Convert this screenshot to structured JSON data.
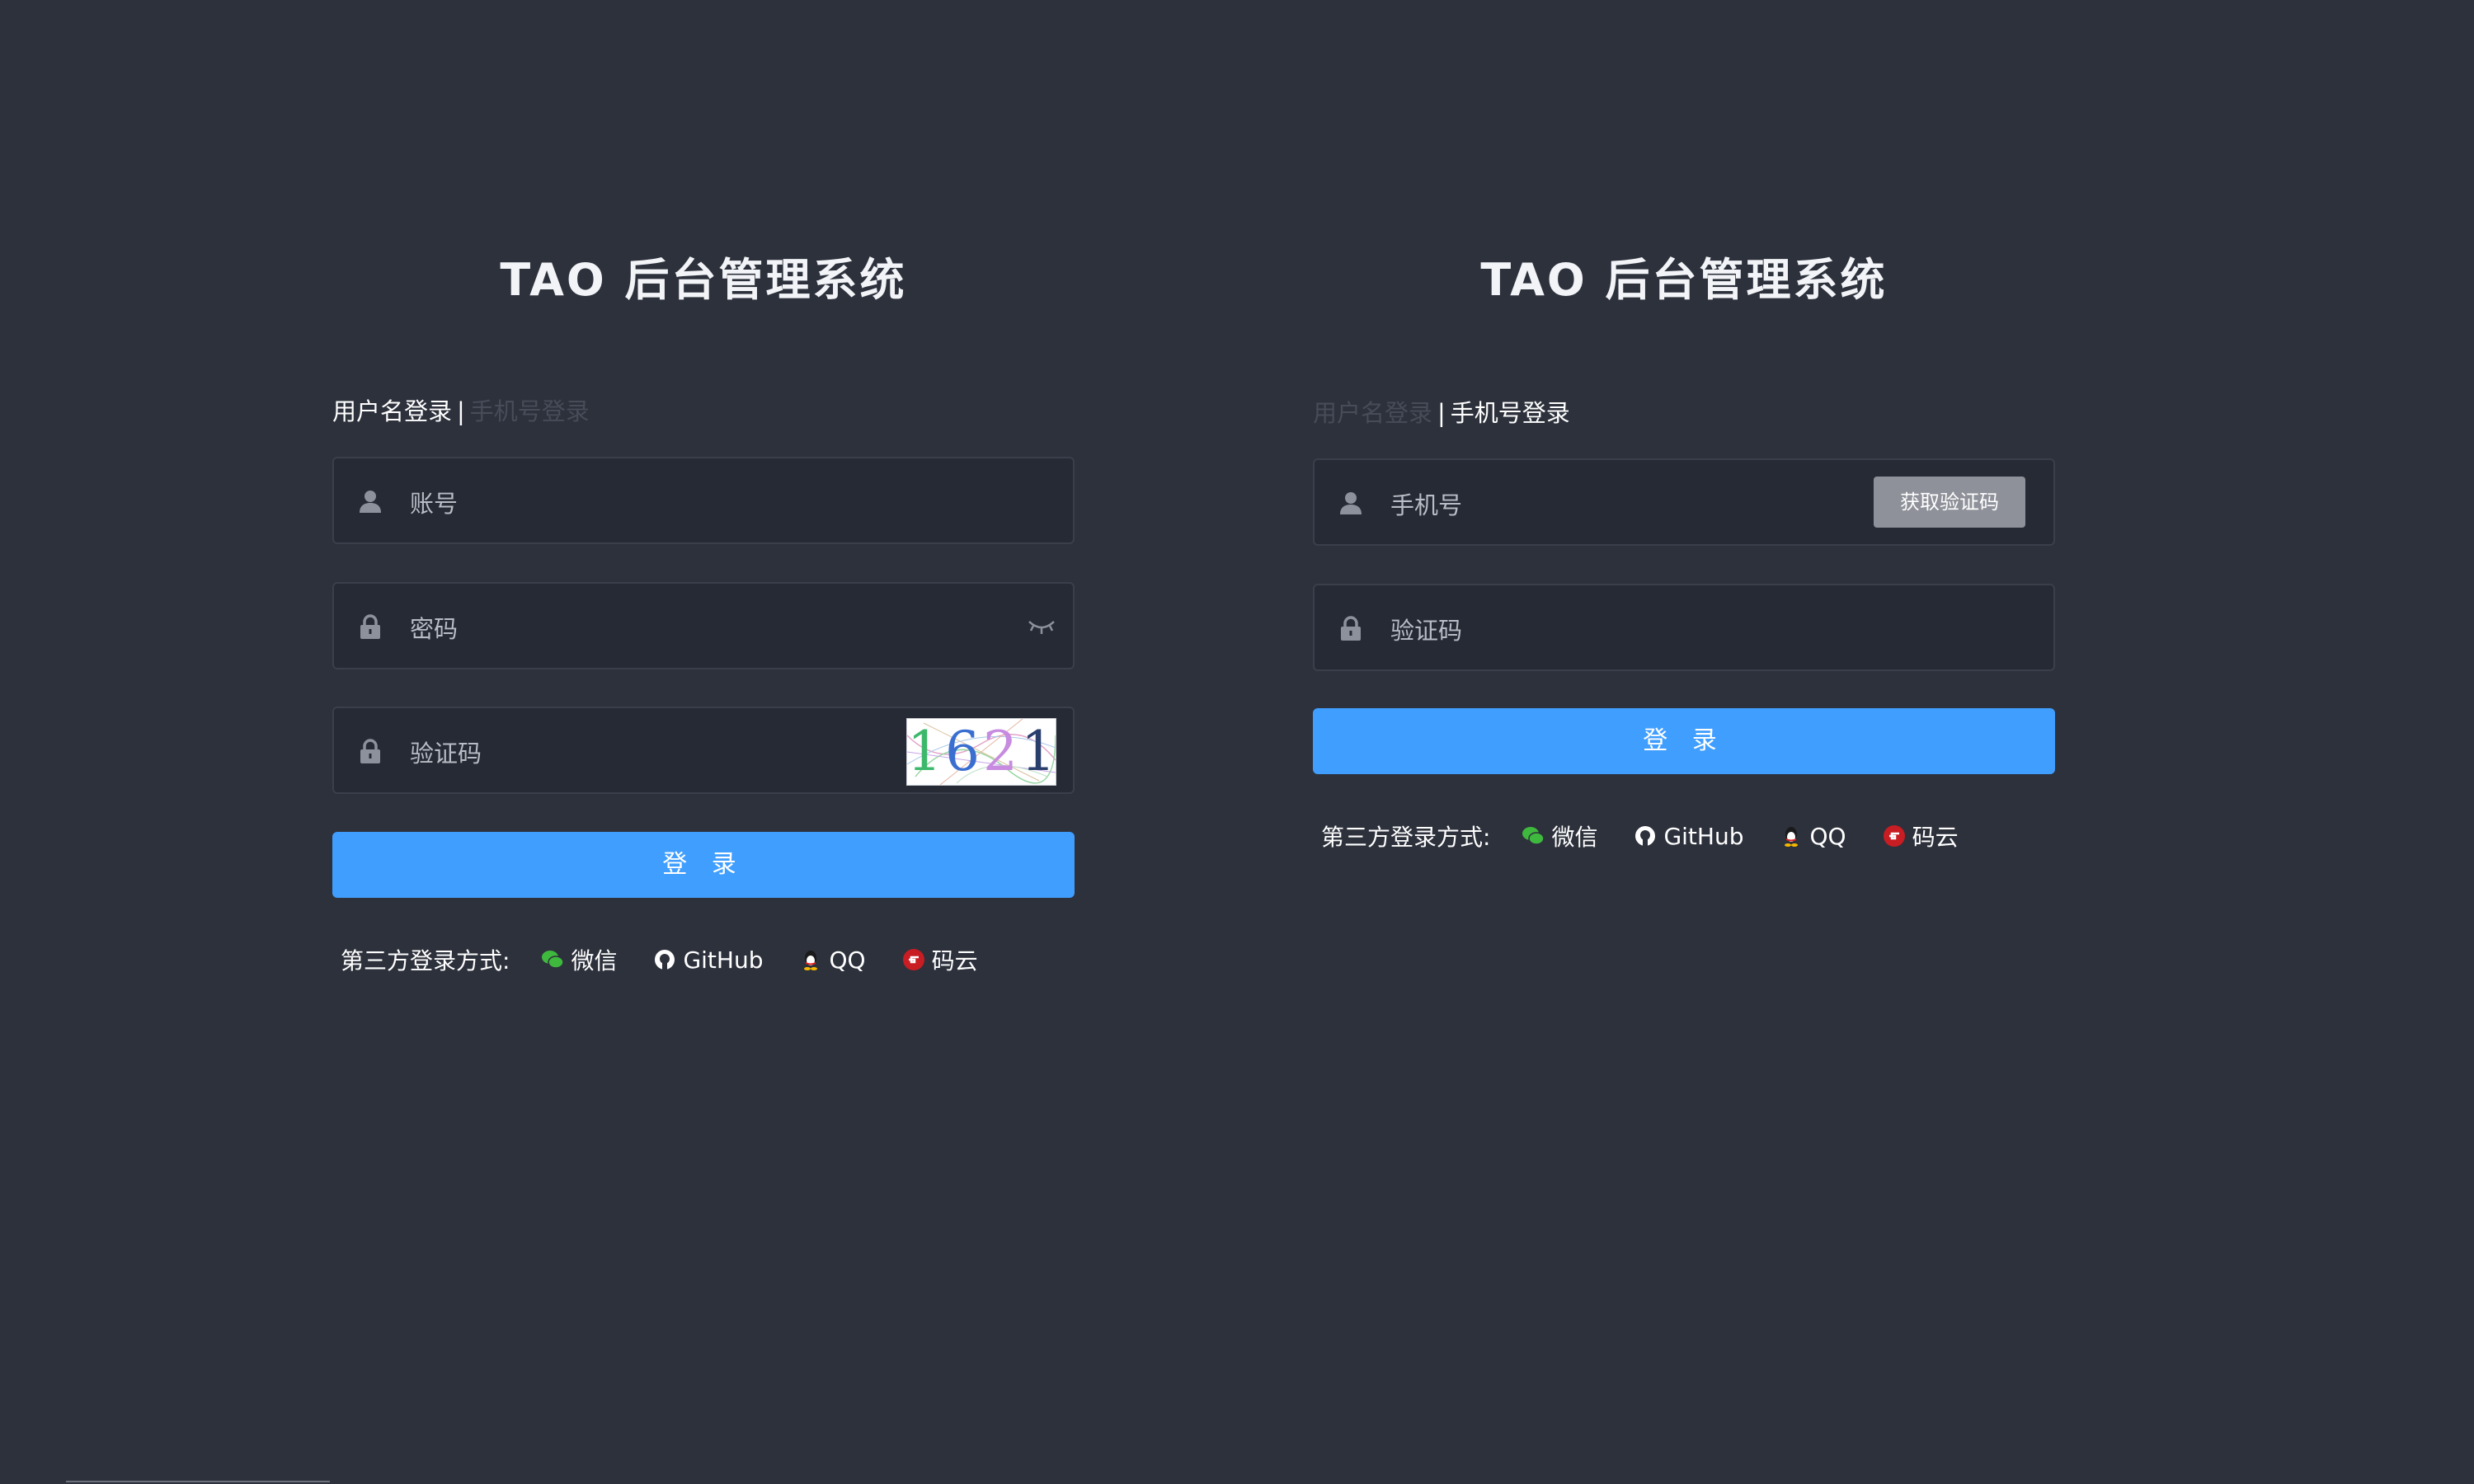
{
  "brand": {
    "title": "TAO 后台管理系统"
  },
  "left_panel": {
    "tabs": {
      "active": "用户名登录",
      "separator": "|",
      "inactive": "手机号登录"
    },
    "account_field": {
      "placeholder": "账号",
      "icon": "user-icon"
    },
    "password_field": {
      "placeholder": "密码",
      "icon": "lock-icon",
      "toggle_icon": "eye-closed-icon"
    },
    "captcha_field": {
      "placeholder": "验证码",
      "icon": "lock-icon",
      "captcha_text": "1621"
    },
    "login_button": "登 录",
    "third_party": {
      "label": "第三方登录方式:",
      "providers": [
        {
          "name": "微信",
          "icon": "wechat-icon",
          "color": "#3fb83e"
        },
        {
          "name": "GitHub",
          "icon": "github-icon",
          "color": "#ffffff"
        },
        {
          "name": "QQ",
          "icon": "qq-icon",
          "color": "#ffffff"
        },
        {
          "name": "码云",
          "icon": "gitee-icon",
          "color": "#c71d23"
        }
      ]
    }
  },
  "right_panel": {
    "tabs": {
      "inactive": "用户名登录",
      "separator": "|",
      "active": "手机号登录"
    },
    "phone_field": {
      "placeholder": "手机号",
      "icon": "user-icon",
      "button": "获取验证码"
    },
    "code_field": {
      "placeholder": "验证码",
      "icon": "lock-icon"
    },
    "login_button": "登 录",
    "third_party": {
      "label": "第三方登录方式:",
      "providers": [
        {
          "name": "微信",
          "icon": "wechat-icon",
          "color": "#3fb83e"
        },
        {
          "name": "GitHub",
          "icon": "github-icon",
          "color": "#ffffff"
        },
        {
          "name": "QQ",
          "icon": "qq-icon",
          "color": "#ffffff"
        },
        {
          "name": "码云",
          "icon": "gitee-icon",
          "color": "#c71d23"
        }
      ]
    }
  },
  "colors": {
    "background": "#2d313c",
    "input_bg": "#262a35",
    "primary": "#409eff",
    "sms_button": "#8e9199"
  }
}
